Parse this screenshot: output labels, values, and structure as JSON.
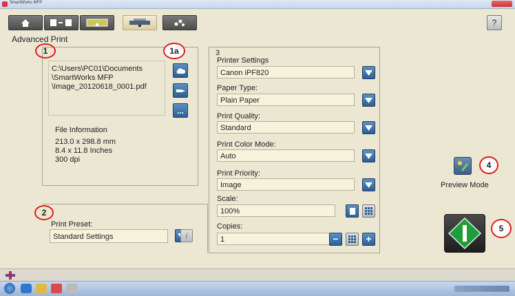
{
  "window": {
    "title": "SmartWorks MFP"
  },
  "nav": {
    "tabs": [
      {
        "name": "home-tab",
        "icon": "home-icon",
        "glyph": "⌂"
      },
      {
        "name": "copy-tab",
        "icon": "copy-icon",
        "glyph": "▮▸▮"
      },
      {
        "name": "scan-tab",
        "icon": "scan-icon",
        "glyph": "▭"
      },
      {
        "name": "print-tab",
        "icon": "print-icon",
        "glyph": "▬"
      },
      {
        "name": "settings-tab",
        "icon": "dots-icon",
        "glyph": "⁘"
      }
    ],
    "help_label": "?"
  },
  "page": {
    "title": "Advanced Print"
  },
  "section1": {
    "number": "1",
    "file_path": [
      "C:\\Users\\PC01\\Documents",
      "\\SmartWorks MFP",
      "\\Image_20120618_0001.pdf"
    ],
    "file_info_label": "File Information",
    "file_info": [
      "213.0 x 298.8 mm",
      "8.4 x 11.8 Inches",
      "300 dpi"
    ],
    "browse_label": "..."
  },
  "section2": {
    "number": "2",
    "preset_label": "Print Preset:",
    "preset_value": "Standard Settings",
    "info_label": "i"
  },
  "section3": {
    "number": "3",
    "printer_label": "Printer Settings",
    "printer_value": "Canon iPF820",
    "paper_label": "Paper Type:",
    "paper_value": "Plain Paper",
    "quality_label": "Print Quality:",
    "quality_value": "Standard",
    "color_label": "Print Color Mode:",
    "color_value": "Auto",
    "priority_label": "Print Priority:",
    "priority_value": "Image",
    "scale_label": "Scale:",
    "scale_value": "100%",
    "copies_label": "Copies:",
    "copies_value": "1",
    "minus_label": "−",
    "plus_label": "+"
  },
  "preview": {
    "label": "Preview Mode"
  },
  "callouts": {
    "c1": "1",
    "c1a": "1a",
    "c2": "2",
    "c4": "4",
    "c5": "5"
  },
  "colors": {
    "accent": "#2d5f95",
    "callout": "#e21b1b",
    "start": "#1e9e3a"
  }
}
